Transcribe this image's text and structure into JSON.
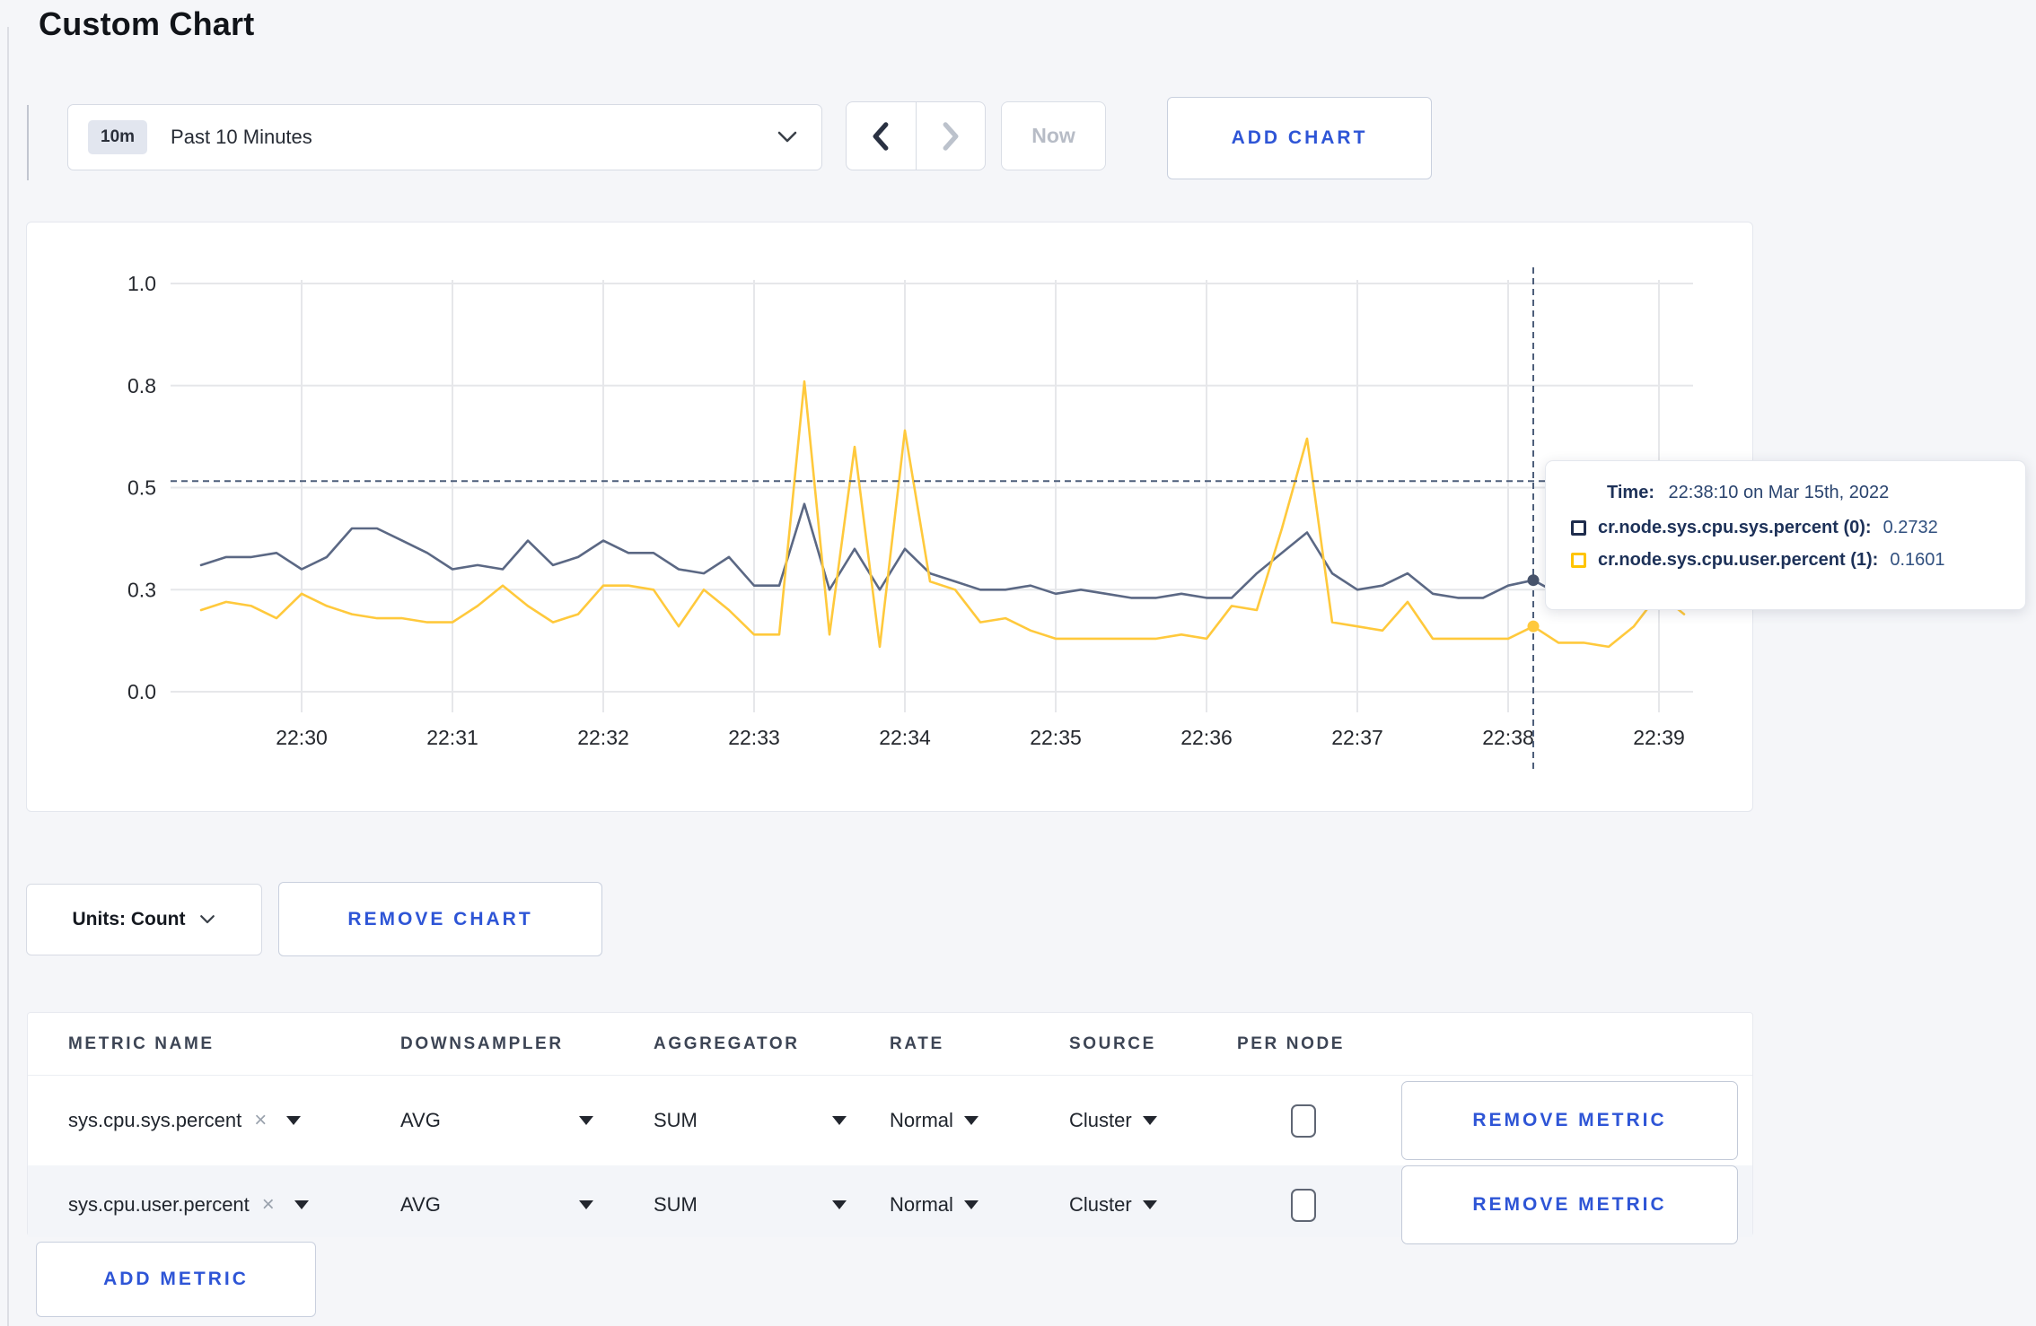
{
  "page": {
    "title": "Custom Chart"
  },
  "toolbar": {
    "time_range": {
      "badge": "10m",
      "label": "Past 10 Minutes"
    },
    "now_label": "Now",
    "add_chart_label": "ADD CHART"
  },
  "tooltip": {
    "time_label": "Time:",
    "time_value": "22:38:10 on Mar 15th, 2022",
    "series": [
      {
        "name": "cr.node.sys.cpu.sys.percent (0):",
        "value": "0.2732",
        "color": "#1f2d4d"
      },
      {
        "name": "cr.node.sys.cpu.user.percent (1):",
        "value": "0.1601",
        "color": "#ffc400"
      }
    ]
  },
  "controls": {
    "units_label": "Units: Count",
    "remove_chart_label": "REMOVE CHART",
    "add_metric_label": "ADD METRIC",
    "remove_metric_label": "REMOVE METRIC"
  },
  "metrics_table": {
    "headers": [
      "METRIC NAME",
      "DOWNSAMPLER",
      "AGGREGATOR",
      "RATE",
      "SOURCE",
      "PER NODE"
    ],
    "rows": [
      {
        "metric": "sys.cpu.sys.percent",
        "close": "×",
        "downsampler": "AVG",
        "aggregator": "SUM",
        "rate": "Normal",
        "source": "Cluster",
        "per_node_checked": false
      },
      {
        "metric": "sys.cpu.user.percent",
        "close": "×",
        "downsampler": "AVG",
        "aggregator": "SUM",
        "rate": "Normal",
        "source": "Cluster",
        "per_node_checked": false
      }
    ]
  },
  "chart_data": {
    "type": "line",
    "title": "",
    "xlabel": "",
    "ylabel": "",
    "ylim": [
      0,
      1
    ],
    "grid": true,
    "x": [
      "22:29:20",
      "22:29:30",
      "22:29:40",
      "22:29:50",
      "22:30:00",
      "22:30:10",
      "22:30:20",
      "22:30:30",
      "22:30:40",
      "22:30:50",
      "22:31:00",
      "22:31:10",
      "22:31:20",
      "22:31:30",
      "22:31:40",
      "22:31:50",
      "22:32:00",
      "22:32:10",
      "22:32:20",
      "22:32:30",
      "22:32:40",
      "22:32:50",
      "22:33:00",
      "22:33:10",
      "22:33:20",
      "22:33:30",
      "22:33:40",
      "22:33:50",
      "22:34:00",
      "22:34:10",
      "22:34:20",
      "22:34:30",
      "22:34:40",
      "22:34:50",
      "22:35:00",
      "22:35:10",
      "22:35:20",
      "22:35:30",
      "22:35:40",
      "22:35:50",
      "22:36:00",
      "22:36:10",
      "22:36:20",
      "22:36:30",
      "22:36:40",
      "22:36:50",
      "22:37:00",
      "22:37:10",
      "22:37:20",
      "22:37:30",
      "22:37:40",
      "22:37:50",
      "22:38:00",
      "22:38:10",
      "22:38:20",
      "22:38:30",
      "22:38:40",
      "22:38:50",
      "22:39:00",
      "22:39:10"
    ],
    "x_ticks": [
      "22:30",
      "22:31",
      "22:32",
      "22:33",
      "22:34",
      "22:35",
      "22:36",
      "22:37",
      "22:38",
      "22:39"
    ],
    "y_ticks": [
      {
        "v": 0.0,
        "label": "0.0"
      },
      {
        "v": 0.25,
        "label": "0.3"
      },
      {
        "v": 0.5,
        "label": "0.5"
      },
      {
        "v": 0.75,
        "label": "0.8"
      },
      {
        "v": 1.0,
        "label": "1.0"
      }
    ],
    "series": [
      {
        "name": "cr.node.sys.cpu.sys.percent",
        "color": "#5b6884",
        "values": [
          0.31,
          0.33,
          0.33,
          0.34,
          0.3,
          0.33,
          0.4,
          0.4,
          0.37,
          0.34,
          0.3,
          0.31,
          0.3,
          0.37,
          0.31,
          0.33,
          0.37,
          0.34,
          0.34,
          0.3,
          0.29,
          0.33,
          0.26,
          0.26,
          0.46,
          0.25,
          0.35,
          0.25,
          0.35,
          0.29,
          0.27,
          0.25,
          0.25,
          0.26,
          0.24,
          0.25,
          0.24,
          0.23,
          0.23,
          0.24,
          0.23,
          0.23,
          0.29,
          0.34,
          0.39,
          0.29,
          0.25,
          0.26,
          0.29,
          0.24,
          0.23,
          0.23,
          0.26,
          0.2732,
          0.24,
          0.26,
          0.25,
          0.25,
          0.26,
          0.25
        ]
      },
      {
        "name": "cr.node.sys.cpu.user.percent",
        "color": "#ffc93c",
        "values": [
          0.2,
          0.22,
          0.21,
          0.18,
          0.24,
          0.21,
          0.19,
          0.18,
          0.18,
          0.17,
          0.17,
          0.21,
          0.26,
          0.21,
          0.17,
          0.19,
          0.26,
          0.26,
          0.25,
          0.16,
          0.25,
          0.2,
          0.14,
          0.14,
          0.76,
          0.14,
          0.6,
          0.11,
          0.64,
          0.27,
          0.25,
          0.17,
          0.18,
          0.15,
          0.13,
          0.13,
          0.13,
          0.13,
          0.13,
          0.14,
          0.13,
          0.21,
          0.2,
          0.4,
          0.62,
          0.17,
          0.16,
          0.15,
          0.22,
          0.13,
          0.13,
          0.13,
          0.13,
          0.1601,
          0.12,
          0.12,
          0.11,
          0.16,
          0.24,
          0.19
        ]
      }
    ],
    "crosshair": {
      "x_index": 53,
      "y_value": 0.516
    },
    "legend_position": "tooltip"
  }
}
